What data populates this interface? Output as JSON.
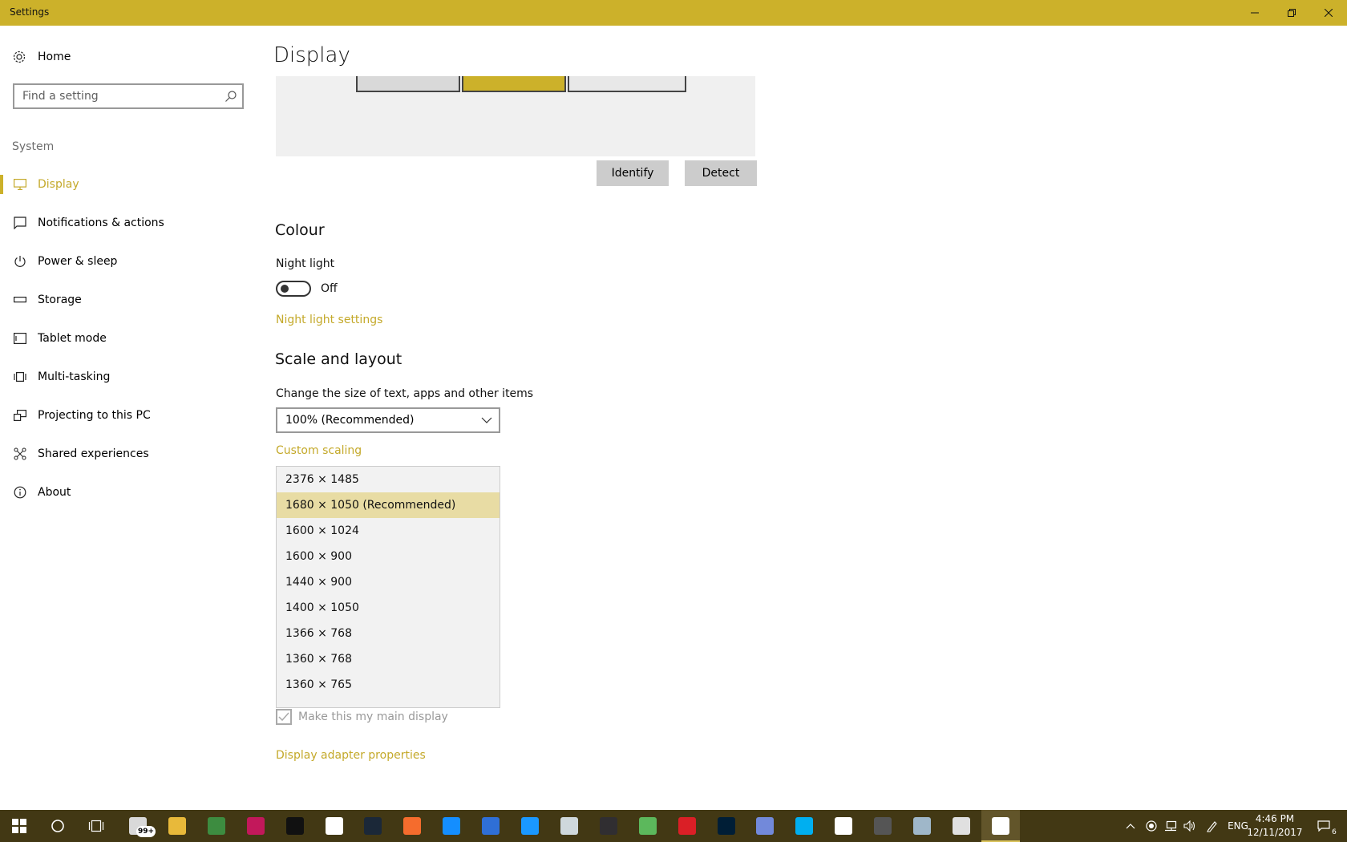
{
  "window": {
    "title": "Settings",
    "accent_color": "#ccb12a",
    "controls": [
      "minimize-icon",
      "restore-icon",
      "close-icon"
    ]
  },
  "sidebar": {
    "home_label": "Home",
    "search_placeholder": "Find a setting",
    "section_label": "System",
    "items": [
      {
        "label": "Display",
        "icon": "monitor-icon",
        "active": true
      },
      {
        "label": "Notifications & actions",
        "icon": "notification-icon"
      },
      {
        "label": "Power & sleep",
        "icon": "power-icon"
      },
      {
        "label": "Storage",
        "icon": "storage-icon"
      },
      {
        "label": "Tablet mode",
        "icon": "tablet-icon"
      },
      {
        "label": "Multi-tasking",
        "icon": "multitasking-icon"
      },
      {
        "label": "Projecting to this PC",
        "icon": "projecting-icon"
      },
      {
        "label": "Shared experiences",
        "icon": "shared-icon"
      },
      {
        "label": "About",
        "icon": "info-icon"
      }
    ]
  },
  "main": {
    "title": "Display",
    "identify_label": "Identify",
    "detect_label": "Detect",
    "colour": {
      "heading": "Colour",
      "night_light_label": "Night light",
      "night_light_state": "Off",
      "night_light_settings_link": "Night light settings"
    },
    "scale": {
      "heading": "Scale and layout",
      "size_label": "Change the size of text, apps and other items",
      "size_value": "100% (Recommended)",
      "custom_scaling_link": "Custom scaling"
    },
    "resolution_options": [
      "2376 × 1485",
      "1680 × 1050 (Recommended)",
      "1600 × 1024",
      "1600 × 900",
      "1440 × 900",
      "1400 × 1050",
      "1366 × 768",
      "1360 × 768",
      "1360 × 765"
    ],
    "resolution_selected": "1680 × 1050 (Recommended)",
    "main_display_label": "Make this my main display",
    "main_display_checked": true,
    "adapter_link": "Display adapter properties"
  },
  "taskbar": {
    "mail_badge": "99+",
    "apps": [
      {
        "name": "mail-app",
        "color": "#d9d9d9"
      },
      {
        "name": "file-explorer",
        "color": "#e8b93a"
      },
      {
        "name": "chrome",
        "color": "#3d8c40"
      },
      {
        "name": "forza-horizon-3",
        "color": "#c2185b"
      },
      {
        "name": "forza-motorsport",
        "color": "#111111"
      },
      {
        "name": "forza-horizon",
        "color": "#ffffff"
      },
      {
        "name": "steam",
        "color": "#1b2838"
      },
      {
        "name": "origin",
        "color": "#f56c2d"
      },
      {
        "name": "battle-net",
        "color": "#148eff"
      },
      {
        "name": "uplay",
        "color": "#2f6fd6"
      },
      {
        "name": "amazon-music",
        "color": "#1a98ff"
      },
      {
        "name": "epic-app",
        "color": "#cfd8dc"
      },
      {
        "name": "obs",
        "color": "#302e31"
      },
      {
        "name": "camtasia",
        "color": "#5cb85c"
      },
      {
        "name": "creative-cloud",
        "color": "#da1f26"
      },
      {
        "name": "photoshop",
        "color": "#001e36"
      },
      {
        "name": "discord",
        "color": "#7289da"
      },
      {
        "name": "skype",
        "color": "#00aff0"
      },
      {
        "name": "groove-music",
        "color": "#ffffff"
      },
      {
        "name": "geforce-experience",
        "color": "#555555"
      },
      {
        "name": "remote-desktop",
        "color": "#9fb7c9"
      },
      {
        "name": "clock-app",
        "color": "#e0e0e0"
      },
      {
        "name": "settings",
        "color": "#ffffff"
      }
    ],
    "language": "ENG",
    "time": "4:46 PM",
    "date": "12/11/2017",
    "notification_count": "6"
  }
}
